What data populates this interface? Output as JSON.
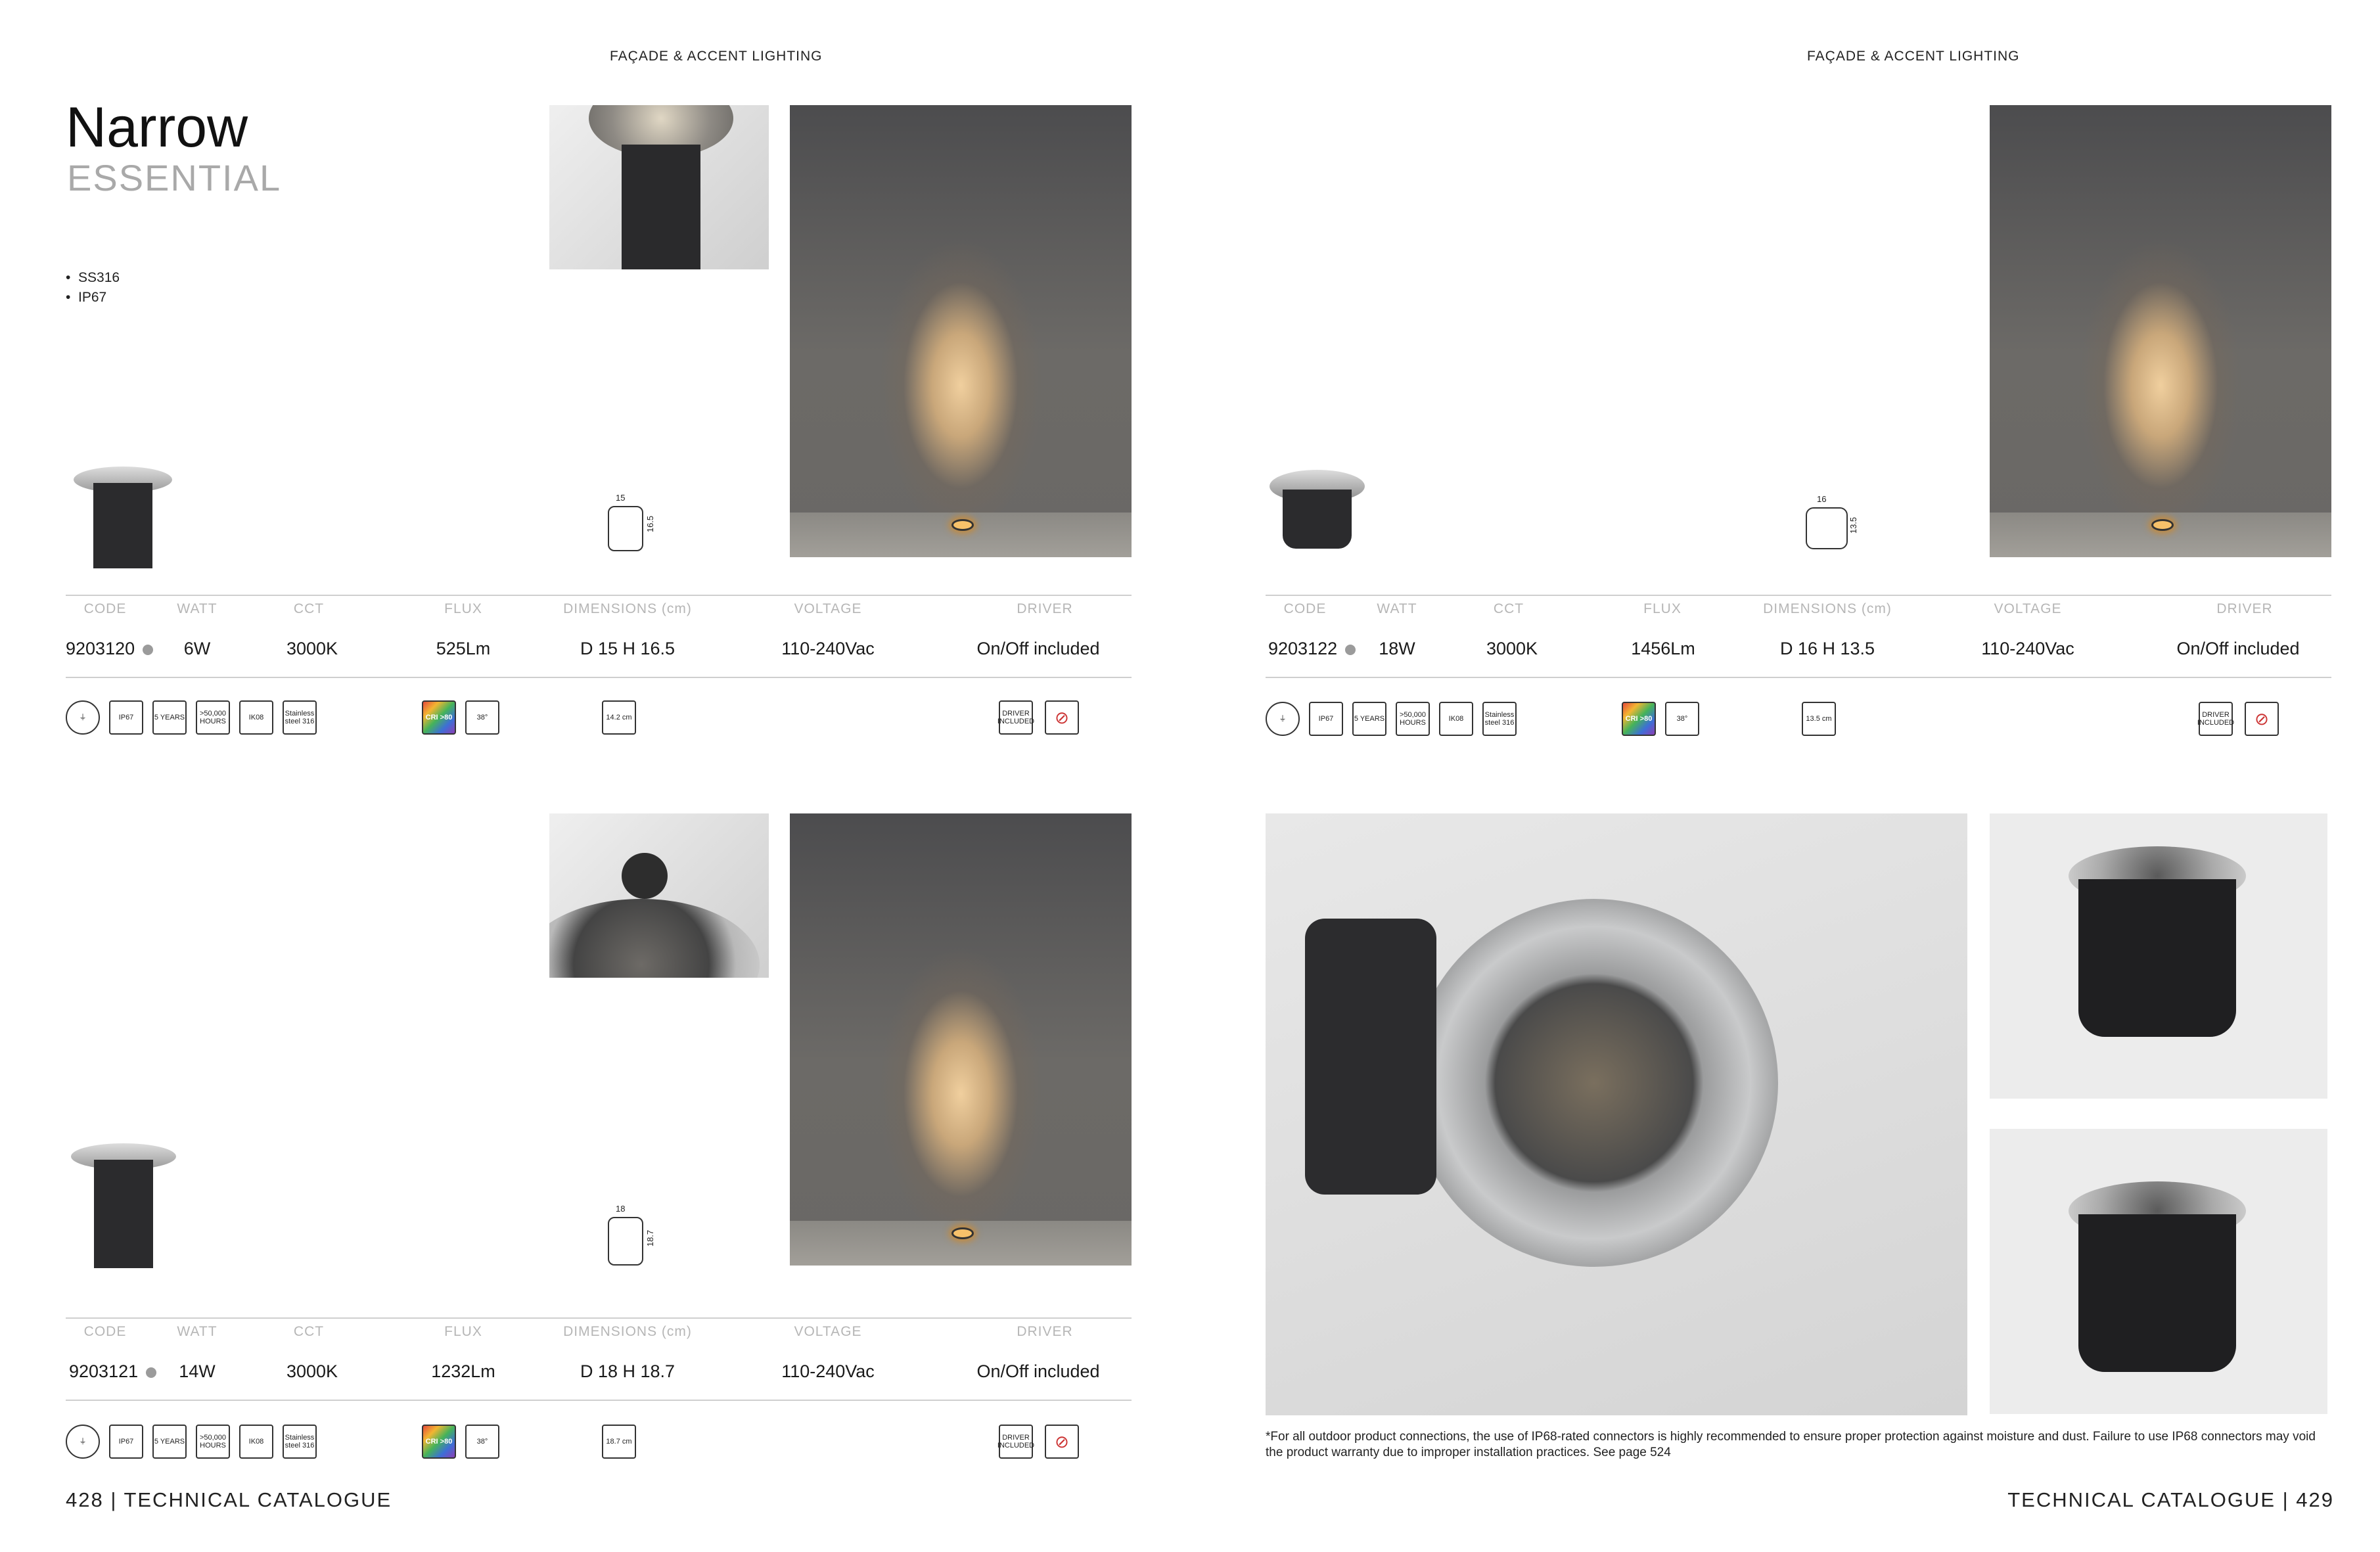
{
  "header": {
    "section_left": "FAÇADE & ACCENT LIGHTING",
    "section_right": "FAÇADE & ACCENT LIGHTING"
  },
  "product": {
    "name": "Narrow",
    "range": "ESSENTIAL",
    "features": [
      "SS316",
      "IP67"
    ]
  },
  "columns": [
    "CODE",
    "WATT",
    "CCT",
    "FLUX",
    "DIMENSIONS (cm)",
    "VOLTAGE",
    "DRIVER"
  ],
  "items": [
    {
      "code": "9203120",
      "watt": "6W",
      "cct": "3000K",
      "flux": "525Lm",
      "dimensions": "D 15 H 16.5",
      "voltage": "110-240Vac",
      "driver": "On/Off included",
      "dim_w": "15",
      "dim_h": "16.5",
      "cutout": "14.2 cm"
    },
    {
      "code": "9203122",
      "watt": "18W",
      "cct": "3000K",
      "flux": "1456Lm",
      "dimensions": "D 16 H 13.5",
      "voltage": "110-240Vac",
      "driver": "On/Off included",
      "dim_w": "16",
      "dim_h": "13.5",
      "cutout": "13.5 cm"
    },
    {
      "code": "9203121",
      "watt": "14W",
      "cct": "3000K",
      "flux": "1232Lm",
      "dimensions": "D 18 H 18.7",
      "voltage": "110-240Vac",
      "driver": "On/Off included",
      "dim_w": "18",
      "dim_h": "18.7",
      "cutout": "18.7 cm"
    }
  ],
  "icons": {
    "ip": "IP67",
    "warranty": "5 YEARS",
    "hours": ">50,000 HOURS",
    "ik": "IK08",
    "material": "Stainless steel 316",
    "cri": "CRI >80",
    "beam": "38°",
    "driver": "DRIVER INCLUDED"
  },
  "note": "*For all outdoor product connections, the use of IP68-rated connectors is highly recommended to ensure proper protection against moisture and dust. Failure to use IP68 connectors may void the product warranty due to improper installation practices. See page 524",
  "footer": {
    "left": "428 | TECHNICAL CATALOGUE",
    "right": "TECHNICAL CATALOGUE | 429"
  }
}
